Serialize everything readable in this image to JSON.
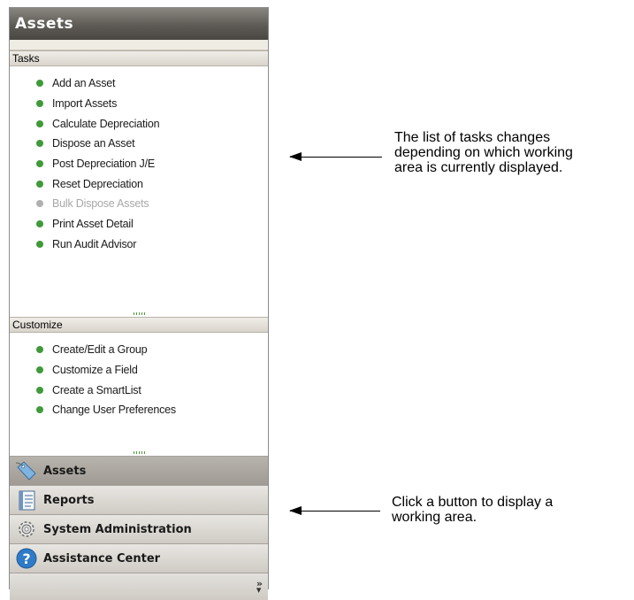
{
  "pane": {
    "title": "Assets"
  },
  "tasks": {
    "header": "Tasks",
    "items": [
      {
        "label": "Add an Asset",
        "enabled": true
      },
      {
        "label": "Import Assets",
        "enabled": true
      },
      {
        "label": "Calculate Depreciation",
        "enabled": true
      },
      {
        "label": "Dispose an Asset",
        "enabled": true
      },
      {
        "label": "Post Depreciation J/E",
        "enabled": true
      },
      {
        "label": "Reset Depreciation",
        "enabled": true
      },
      {
        "label": "Bulk Dispose Assets",
        "enabled": false
      },
      {
        "label": "Print Asset Detail",
        "enabled": true
      },
      {
        "label": "Run Audit Advisor",
        "enabled": true
      }
    ]
  },
  "customize": {
    "header": "Customize",
    "items": [
      {
        "label": "Create/Edit a Group"
      },
      {
        "label": "Customize a Field"
      },
      {
        "label": "Create a SmartList"
      },
      {
        "label": "Change User Preferences"
      }
    ]
  },
  "nav_buttons": [
    {
      "label": "Assets",
      "icon": "assets-tag-icon",
      "active": true
    },
    {
      "label": "Reports",
      "icon": "reports-icon",
      "active": false
    },
    {
      "label": "System Administration",
      "icon": "gear-icon",
      "active": false
    },
    {
      "label": "Assistance Center",
      "icon": "help-icon",
      "active": false
    }
  ],
  "footer": {
    "icon": "chevron-double-down-icon"
  },
  "colors": {
    "bullet_enabled": "#3f9a3a",
    "bullet_disabled": "#b0b0b0",
    "header_dark": "#5e5a55"
  },
  "callouts": {
    "tasks_note": [
      "The list of tasks changes",
      "depending on which working",
      "area is currently displayed."
    ],
    "buttons_note": [
      "Click a button to display a",
      "working area."
    ]
  }
}
